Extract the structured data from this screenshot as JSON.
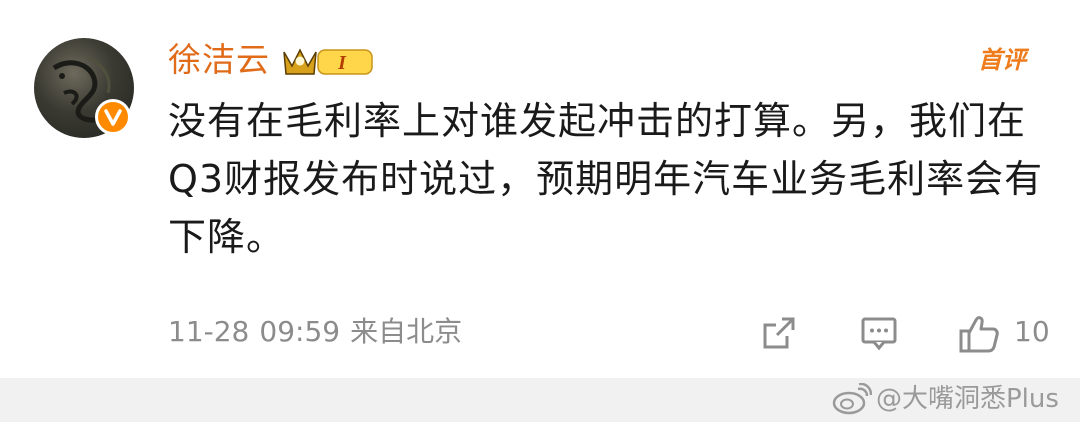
{
  "comment": {
    "username": "徐洁云",
    "member_level": "I",
    "first_comment_label": "首评",
    "text": "没有在毛利率上对谁发起冲击的打算。另，我们在Q3财报发布时说过，预期明年汽车业务毛利率会有下降。",
    "date": "11-28",
    "time": "09:59",
    "location": "来自北京",
    "like_count": "10"
  },
  "watermark": {
    "text": "@大嘴洞悉Plus"
  },
  "colors": {
    "username": "#e06b19",
    "badge": "#ff8a00",
    "meta": "#8c8c8c"
  },
  "icons": [
    "avatar",
    "verified-icon",
    "crown-icon",
    "share-icon",
    "comment-icon",
    "like-icon",
    "weibo-logo-icon"
  ]
}
